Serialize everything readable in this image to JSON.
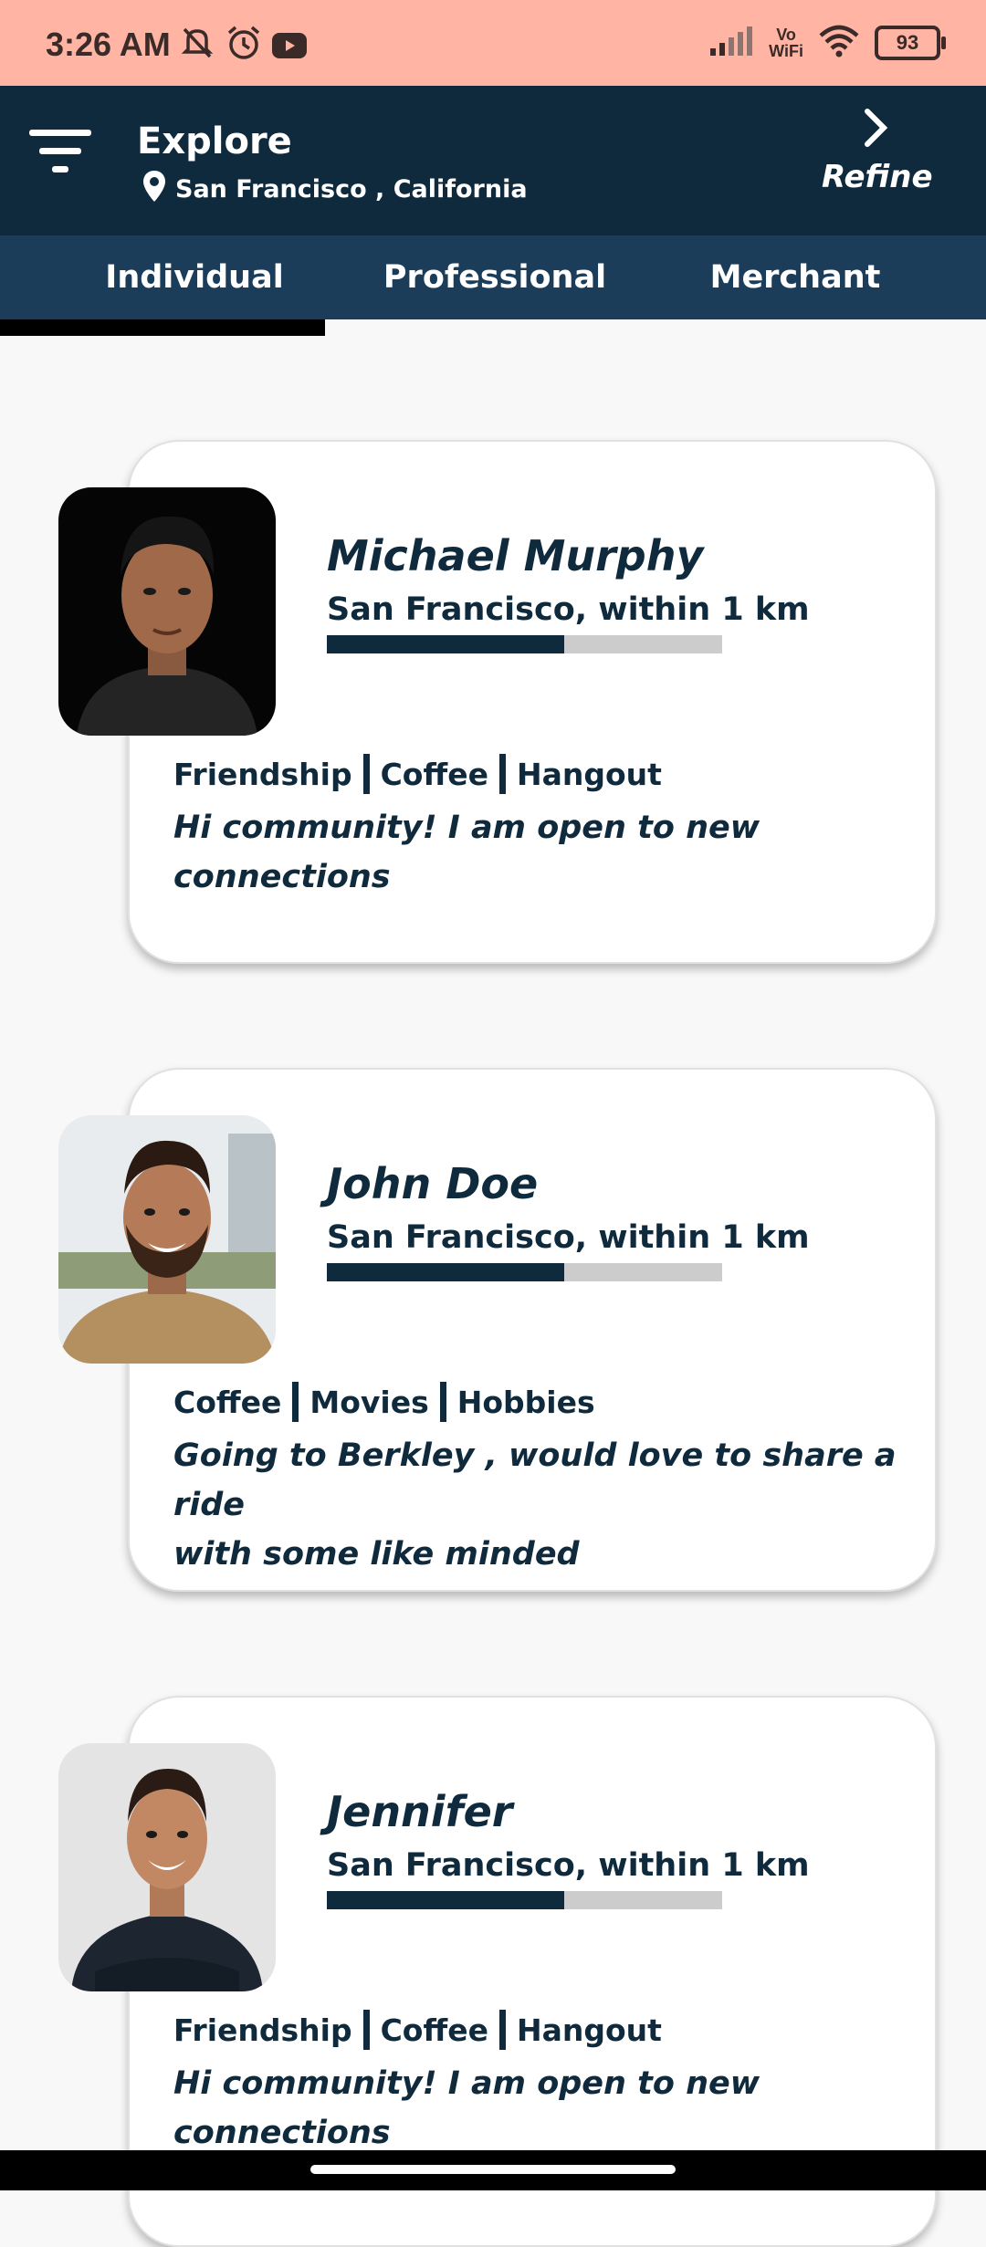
{
  "status_bar": {
    "time": "3:26 AM",
    "battery": "93",
    "vowifi_top": "Vo",
    "vowifi_bottom": "WiFi",
    "icons": [
      "mute-bell-icon",
      "alarm-icon",
      "youtube-icon",
      "signal-icon",
      "wifi-icon",
      "battery-icon"
    ]
  },
  "header": {
    "title": "Explore",
    "location": "San Francisco , California",
    "refine_label": "Refine"
  },
  "tabs": [
    {
      "label": "Individual",
      "active": true
    },
    {
      "label": "Professional",
      "active": false
    },
    {
      "label": "Merchant",
      "active": false
    }
  ],
  "profiles": [
    {
      "name": "Michael Murphy",
      "location": "San Francisco, within 1 km",
      "progress": 0.6,
      "tags": [
        "Friendship",
        "Coffee",
        "Hangout"
      ],
      "description": "Hi community! I am open to new connections"
    },
    {
      "name": "John Doe",
      "location": "San Francisco, within 1 km",
      "progress": 0.6,
      "tags": [
        "Coffee",
        "Movies",
        "Hobbies"
      ],
      "description_line1": "Going to Berkley , would love to share a ride",
      "description_line2": "with some like minded"
    },
    {
      "name": "Jennifer",
      "location": "San Francisco, within 1 km",
      "progress": 0.6,
      "tags": [
        "Friendship",
        "Coffee",
        "Hangout"
      ],
      "description": "Hi community! I am open to new connections"
    }
  ],
  "colors": {
    "status_bar": "#ffb4a4",
    "header": "#0f2a3c",
    "tabs": "#1b3d5a",
    "accent": "#0f2a3c",
    "bar_track": "#cccccc"
  }
}
